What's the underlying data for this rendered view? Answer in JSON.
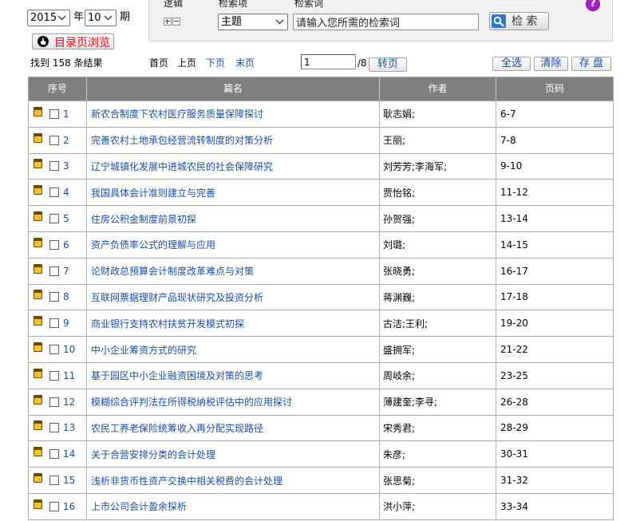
{
  "filters": {
    "year": "2015",
    "year_unit": "年",
    "issue": "10",
    "issue_unit": "期",
    "toc_button": "目录页浏览"
  },
  "search": {
    "logic_label": "逻辑",
    "field_label": "检索项",
    "term_label": "检索词",
    "field_value": "主题",
    "term_value": "请输入您所需的检索词",
    "button_label": "检 索",
    "help_label": "?"
  },
  "toolbar": {
    "result_summary": "找到 158 条结果",
    "first_page": "首页",
    "prev_page": "上页",
    "next_page": "下页",
    "last_page": "末页",
    "page_input": "1",
    "page_total": "/8",
    "goto_button": "转页",
    "select_all": "全选",
    "clear": "清除",
    "save": "存 盘"
  },
  "table": {
    "headers": {
      "no": "序号",
      "title": "篇名",
      "author": "作者",
      "pages": "页码"
    },
    "rows": [
      {
        "no": "1",
        "title": "新农合制度下农村医疗服务质量保障探讨",
        "author": "耿志娟;",
        "pages": "6-7"
      },
      {
        "no": "2",
        "title": "完善农村土地承包经营流转制度的对策分析",
        "author": "王丽;",
        "pages": "7-8"
      },
      {
        "no": "3",
        "title": "辽宁城镇化发展中进城农民的社会保障研究",
        "author": "刘芳芳;李海军;",
        "pages": "9-10"
      },
      {
        "no": "4",
        "title": "我国具体会计准则建立与完善",
        "author": "贾怡铭;",
        "pages": "11-12"
      },
      {
        "no": "5",
        "title": "住房公积金制度前景初探",
        "author": "孙贺强;",
        "pages": "13-14"
      },
      {
        "no": "6",
        "title": "资产负债率公式的理解与应用",
        "author": "刘璐;",
        "pages": "14-15"
      },
      {
        "no": "7",
        "title": "论财政总预算会计制度改革难点与对策",
        "author": "张晓勇;",
        "pages": "16-17"
      },
      {
        "no": "8",
        "title": "互联网票据理财产品现状研究及投资分析",
        "author": "蒋渊巍;",
        "pages": "17-18"
      },
      {
        "no": "9",
        "title": "商业银行支持农村扶贫开发模式初探",
        "author": "古洁;王利;",
        "pages": "19-20"
      },
      {
        "no": "10",
        "title": "中小企业筹资方式的研究",
        "author": "盛拥军;",
        "pages": "21-22"
      },
      {
        "no": "11",
        "title": "基于园区中小企业融资困境及对策的思考",
        "author": "周岐余;",
        "pages": "23-25"
      },
      {
        "no": "12",
        "title": "模糊综合评判法在所得税纳税评估中的应用探讨",
        "author": "薄建奎;李寻;",
        "pages": "26-28"
      },
      {
        "no": "13",
        "title": "农民工养老保险统筹收入再分配实现路径",
        "author": "宋秀君;",
        "pages": "28-29"
      },
      {
        "no": "14",
        "title": "关于合营安排分类的会计处理",
        "author": "朱彦;",
        "pages": "30-31"
      },
      {
        "no": "15",
        "title": "浅析非货币性资产交换中相关税费的会计处理",
        "author": "张思菊;",
        "pages": "31-32"
      },
      {
        "no": "16",
        "title": "上市公司会计盈余探析",
        "author": "洪小萍;",
        "pages": "33-34"
      }
    ]
  },
  "icons": {
    "toc": "hand-pointer-icon",
    "search": "search-icon",
    "help": "help-icon",
    "expand": "plus-box-icon",
    "collapse": "minus-box-icon",
    "article": "document-icon",
    "dropdown": "chevron-down-icon"
  },
  "colors": {
    "link": "#1a4c9e",
    "header_bg": "#7f7f7f",
    "toc_text": "#e60012",
    "help_bg": "#a321c3",
    "search_icon_bg": "#2f78c8",
    "panel_bg": "#f1f1f1"
  }
}
